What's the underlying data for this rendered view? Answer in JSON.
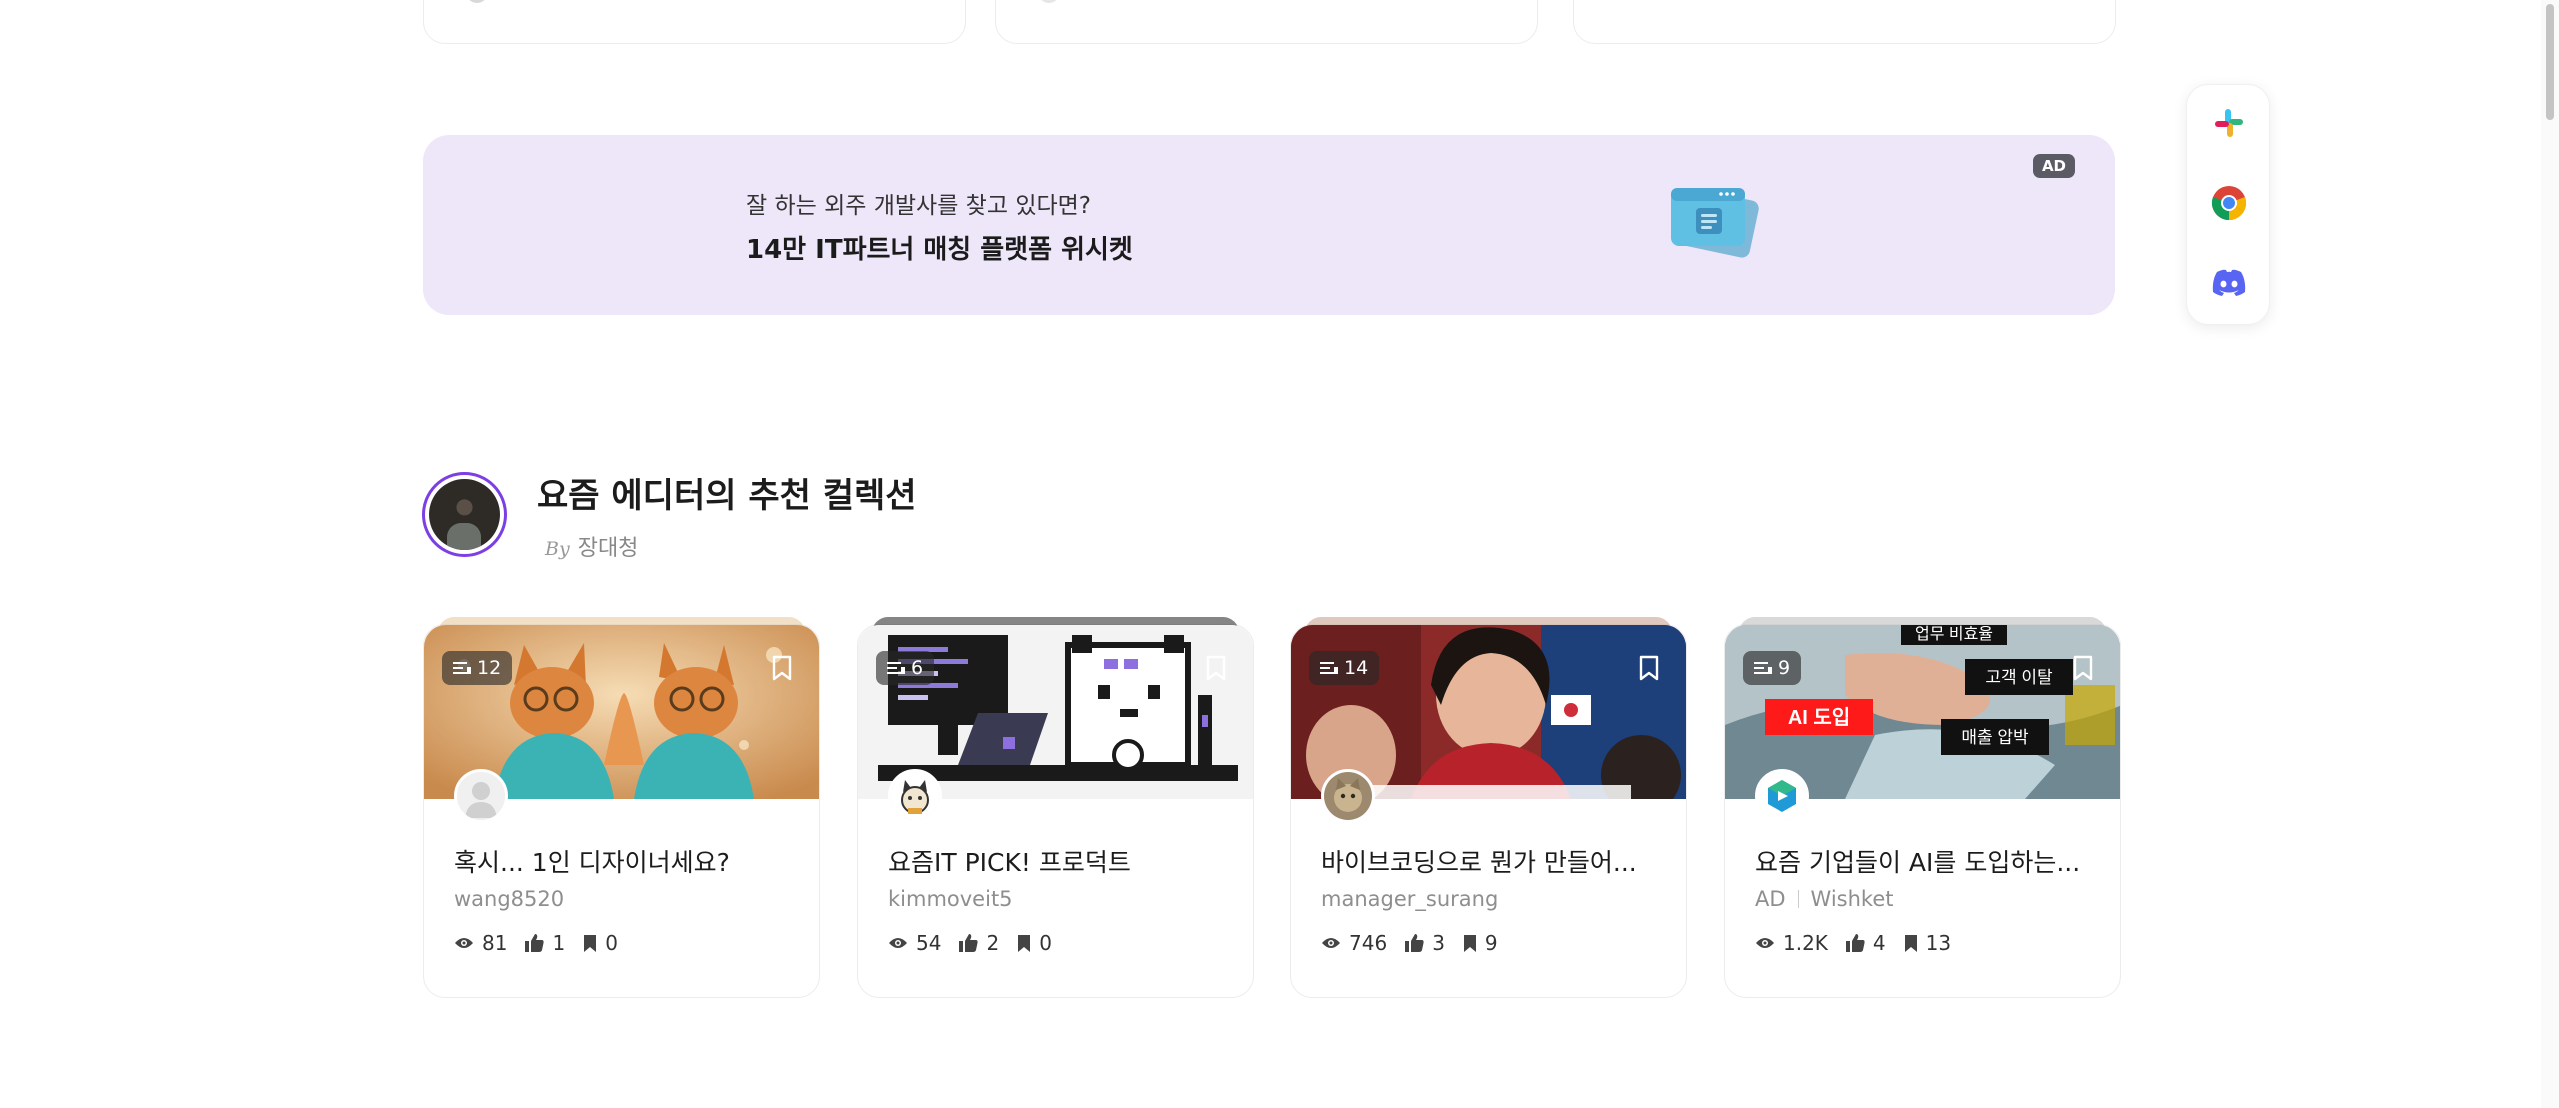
{
  "ad": {
    "line1": "잘 하는 외주 개발사를 찾고 있다면?",
    "line2": "14만 IT파트너 매칭 플랫폼 위시켓",
    "badge": "AD"
  },
  "dock": {
    "items": [
      {
        "icon": "slack-icon"
      },
      {
        "icon": "chrome-icon"
      },
      {
        "icon": "discord-icon"
      }
    ]
  },
  "collection": {
    "title": "요즘 에디터의 추천 컬렉션",
    "by_label": "By",
    "curator": "장대청"
  },
  "cards": [
    {
      "count": "12",
      "title": "혹시... 1인 디자이너세요?",
      "author": "wang8520",
      "ad_label": "",
      "views": "81",
      "likes": "1",
      "bookmarks": "0"
    },
    {
      "count": "6",
      "title": "요즘IT PICK! 프로덕트",
      "author": "kimmoveit5",
      "ad_label": "",
      "views": "54",
      "likes": "2",
      "bookmarks": "0"
    },
    {
      "count": "14",
      "title": "바이브코딩으로 뭔가 만들어...",
      "author": "manager_surang",
      "ad_label": "",
      "views": "746",
      "likes": "3",
      "bookmarks": "9"
    },
    {
      "count": "9",
      "title": "요즘 기업들이 AI를 도입하는...",
      "author": "Wishket",
      "ad_label": "AD",
      "views": "1.2K",
      "likes": "4",
      "bookmarks": "13",
      "image_labels": {
        "top": "업무 비효율",
        "red": "AI 도입",
        "churn": "고객 이탈",
        "sales": "매출 압박"
      }
    }
  ],
  "colors": {
    "ad_bg": "#eee6f9",
    "avatar_ring": "#7b3fe4",
    "card_border": "#ececec"
  }
}
